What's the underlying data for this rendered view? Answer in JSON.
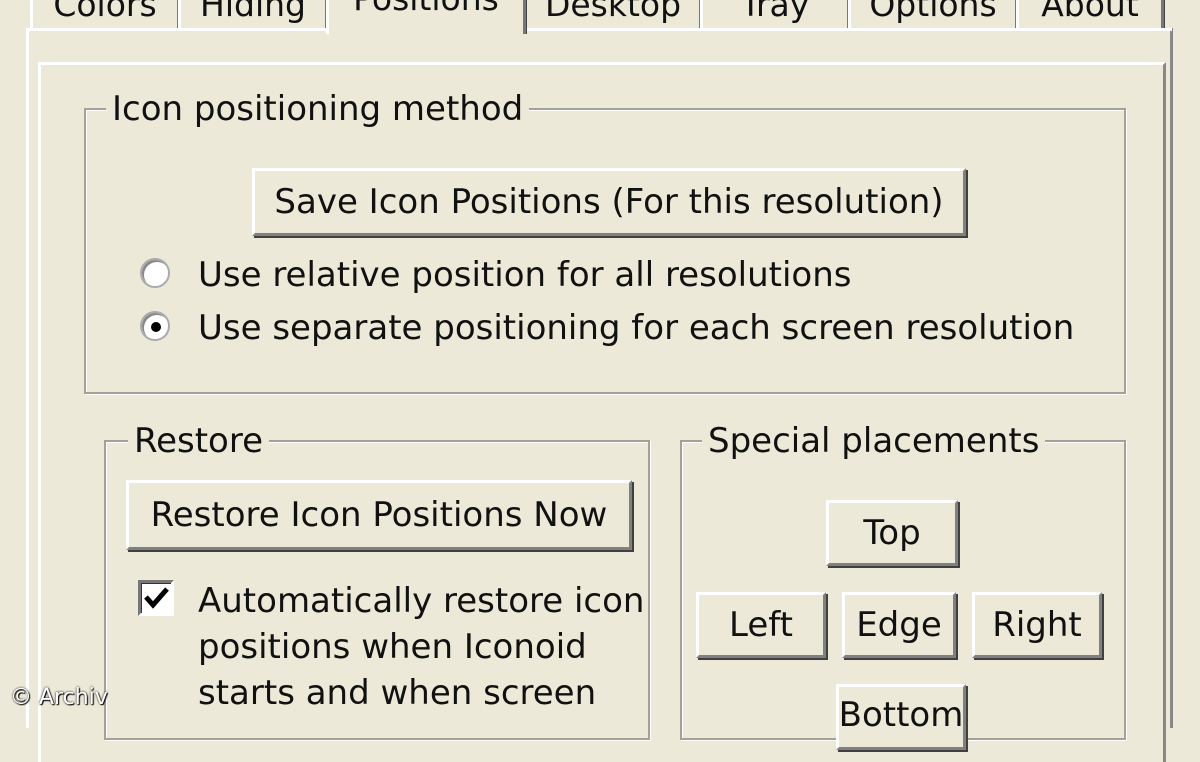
{
  "tabs": [
    "Colors",
    "Hiding",
    "Positions",
    "Desktop",
    "Tray",
    "Options",
    "About"
  ],
  "active_tab": "Positions",
  "positioning_group": {
    "legend": "Icon positioning method",
    "save_button": "Save Icon Positions (For this resolution)",
    "radio_relative": "Use relative position for all resolutions",
    "radio_separate": "Use separate positioning for each screen resolution",
    "selected": "separate"
  },
  "restore_group": {
    "legend": "Restore",
    "restore_button": "Restore Icon Positions Now",
    "auto_restore_line1": "Automatically restore icon",
    "auto_restore_line2": "positions when Iconoid",
    "auto_restore_line3": "starts and when screen",
    "auto_restore_checked": true
  },
  "special_group": {
    "legend": "Special placements",
    "top": "Top",
    "left": "Left",
    "edge": "Edge",
    "right": "Right",
    "bottom": "Bottom"
  },
  "watermark": "© Archiv"
}
